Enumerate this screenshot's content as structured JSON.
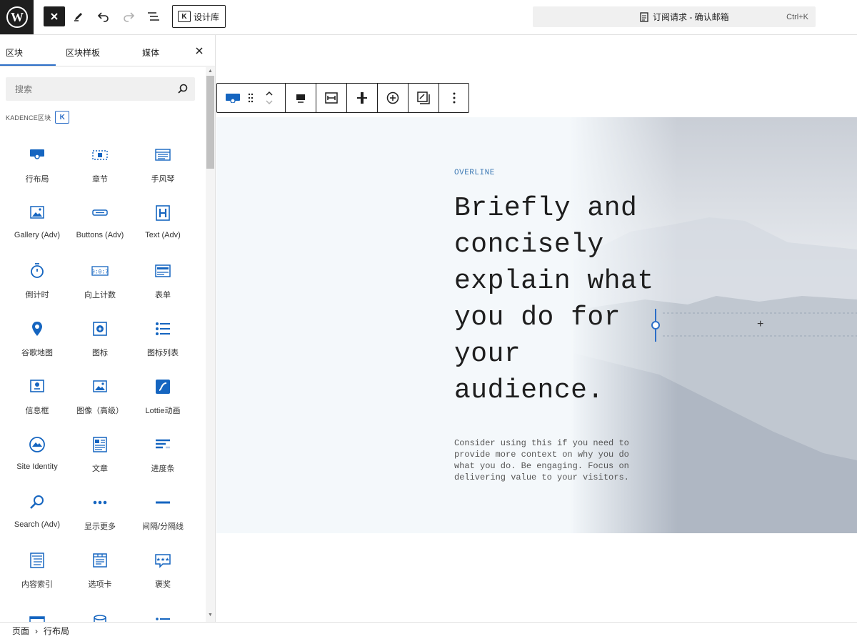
{
  "topbar": {
    "design_library_label": "设计库",
    "command_center_title": "订阅请求 - 确认邮箱",
    "command_center_shortcut": "Ctrl+K"
  },
  "sidebar": {
    "tabs": [
      {
        "label": "区块",
        "active": true
      },
      {
        "label": "区块样板",
        "active": false
      },
      {
        "label": "媒体",
        "active": false
      }
    ],
    "search_placeholder": "搜索",
    "category_label": "KADENCE区块",
    "blocks": [
      {
        "label": "行布局",
        "icon": "row-layout-icon"
      },
      {
        "label": "章节",
        "icon": "section-icon"
      },
      {
        "label": "手风琴",
        "icon": "accordion-icon"
      },
      {
        "label": "Gallery (Adv)",
        "icon": "gallery-icon"
      },
      {
        "label": "Buttons (Adv)",
        "icon": "buttons-icon"
      },
      {
        "label": "Text (Adv)",
        "icon": "heading-icon"
      },
      {
        "label": "倒计时",
        "icon": "countdown-icon"
      },
      {
        "label": "向上计数",
        "icon": "countup-icon"
      },
      {
        "label": "表单",
        "icon": "form-icon"
      },
      {
        "label": "谷歌地图",
        "icon": "map-pin-icon"
      },
      {
        "label": "图标",
        "icon": "icon-block-icon"
      },
      {
        "label": "图标列表",
        "icon": "icon-list-icon"
      },
      {
        "label": "信息框",
        "icon": "infobox-icon"
      },
      {
        "label": "图像（高级）",
        "icon": "image-adv-icon"
      },
      {
        "label": "Lottie动画",
        "icon": "lottie-icon"
      },
      {
        "label": "Site Identity",
        "icon": "site-identity-icon"
      },
      {
        "label": "文章",
        "icon": "posts-icon"
      },
      {
        "label": "进度条",
        "icon": "progress-bar-icon"
      },
      {
        "label": "Search (Adv)",
        "icon": "search-adv-icon"
      },
      {
        "label": "显示更多",
        "icon": "show-more-icon"
      },
      {
        "label": "间隔/分隔线",
        "icon": "spacer-icon"
      },
      {
        "label": "内容索引",
        "icon": "toc-icon"
      },
      {
        "label": "选项卡",
        "icon": "tabs-icon"
      },
      {
        "label": "褒奖",
        "icon": "testimonials-icon"
      },
      {
        "label": "",
        "icon": "partial-icon-1"
      },
      {
        "label": "",
        "icon": "partial-icon-2"
      },
      {
        "label": "",
        "icon": "partial-icon-3"
      }
    ]
  },
  "hero": {
    "overline": "OVERLINE",
    "headline": "Briefly and concisely explain what you do for your audience.",
    "body": "Consider using this if you need to provide more context on why you do what you do. Be engaging. Focus on delivering value to your visitors."
  },
  "breadcrumb": {
    "items": [
      "页面",
      "行布局"
    ],
    "separator": "›"
  },
  "colors": {
    "accent": "#2c6ec7",
    "block_icon": "#1565c0",
    "overline": "#3e7ab5",
    "hero_bg": "#f4f8fb"
  }
}
